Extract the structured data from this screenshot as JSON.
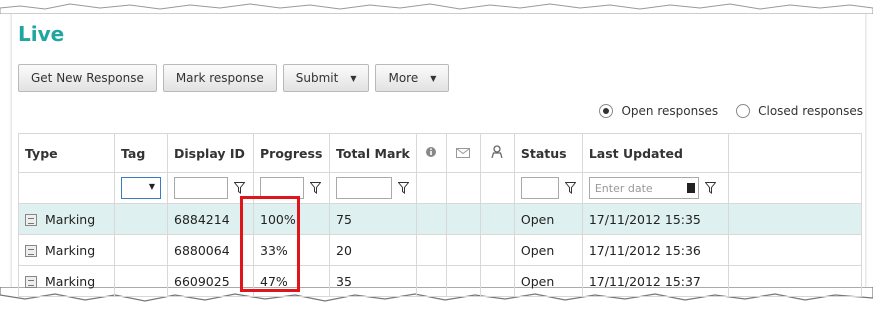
{
  "page": {
    "title": "Live"
  },
  "toolbar": {
    "get_new_response": "Get New Response",
    "mark_response": "Mark response",
    "submit": "Submit",
    "more": "More"
  },
  "response_filter": {
    "open": "Open responses",
    "closed": "Closed responses",
    "selected": "open"
  },
  "table": {
    "headers": {
      "type": "Type",
      "tag": "Tag",
      "display_id": "Display ID",
      "progress": "Progress",
      "total_mark": "Total Mark",
      "status": "Status",
      "last_updated": "Last Updated"
    },
    "date_placeholder": "Enter date",
    "rows": [
      {
        "type": "Marking",
        "tag": "",
        "display_id": "6884214",
        "progress": "100%",
        "total_mark": "75",
        "status": "Open",
        "last_updated": "17/11/2012 15:35"
      },
      {
        "type": "Marking",
        "tag": "",
        "display_id": "6880064",
        "progress": "33%",
        "total_mark": "20",
        "status": "Open",
        "last_updated": "17/11/2012 15:36"
      },
      {
        "type": "Marking",
        "tag": "",
        "display_id": "6609025",
        "progress": "47%",
        "total_mark": "35",
        "status": "Open",
        "last_updated": "17/11/2012 15:37"
      }
    ]
  },
  "colors": {
    "title": "#20a5a0",
    "selected_row": "#dff0f0",
    "highlight_box": "#e0141b"
  }
}
